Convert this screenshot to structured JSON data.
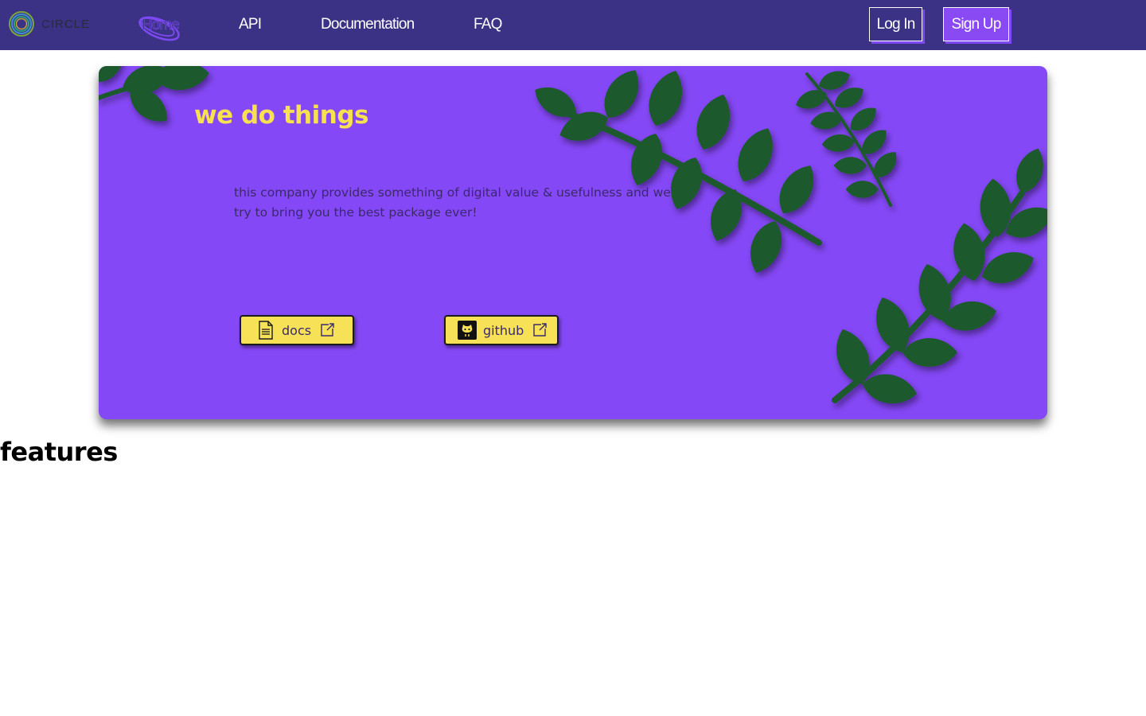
{
  "navbar": {
    "logo_text": "CIRCLE",
    "links": {
      "home": "Home",
      "api": "API",
      "documentation": "Documentation",
      "faq": "FAQ"
    },
    "login_label": "Log In",
    "signup_label": "Sign Up"
  },
  "hero": {
    "title": "we do things",
    "description": "this company provides something of digital value & usefulness and we try to bring you the best package ever!",
    "buttons": {
      "docs": {
        "label": "docs",
        "icon": "document-icon"
      },
      "github": {
        "label": "github",
        "icon": "github-icon"
      }
    }
  },
  "features": {
    "heading": "features"
  },
  "colors": {
    "navbar_bg": "#3b3285",
    "hero_bg": "#8548f6",
    "accent_yellow": "#f7e257",
    "leaf_green": "#1f5a2e",
    "signup_bg": "#8a4af3"
  }
}
